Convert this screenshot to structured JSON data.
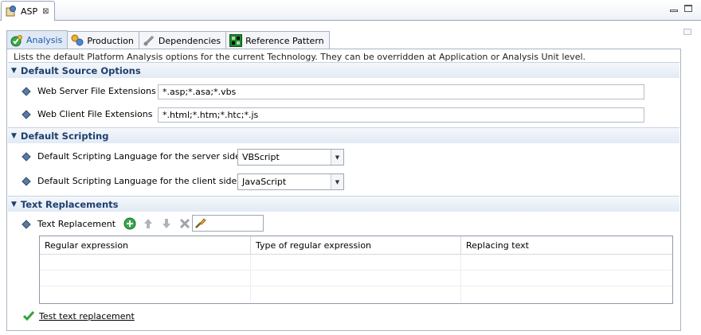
{
  "editor": {
    "tab_title": "ASP",
    "close_glyph": "⊠"
  },
  "inner_tabs": [
    {
      "label": "Analysis",
      "icon": "analysis-icon",
      "active": true
    },
    {
      "label": "Production",
      "icon": "production-icon",
      "active": false
    },
    {
      "label": "Dependencies",
      "icon": "dependencies-icon",
      "active": false
    },
    {
      "label": "Reference Pattern",
      "icon": "reference-pattern-icon",
      "active": false
    }
  ],
  "description": "Lists the default Platform Analysis options for the current Technology. They can be overridden at Application or Analysis Unit level.",
  "sections": {
    "source": {
      "title": "Default Source Options",
      "server_label": "Web Server File Extensions",
      "server_value": "*.asp;*.asa;*.vbs",
      "client_label": "Web Client File Extensions",
      "client_value": "*.html;*.htm;*.htc;*.js"
    },
    "scripting": {
      "title": "Default Scripting",
      "server_label": "Default Scripting Language for the server side",
      "server_value": "VBScript",
      "client_label": "Default Scripting Language for the client side",
      "client_value": "JavaScript"
    },
    "replacements": {
      "title": "Text Replacements",
      "label": "Text Replacement",
      "filter_value": "",
      "columns": [
        "Regular expression",
        "Type of regular expression",
        "Replacing text"
      ],
      "rows": [],
      "test_link": "Test text replacement"
    }
  },
  "colors": {
    "section_title": "#1e3f6e",
    "active_tab_text": "#1f5ba8",
    "add_icon": "#3aa84a",
    "check_icon": "#2fa33a"
  }
}
